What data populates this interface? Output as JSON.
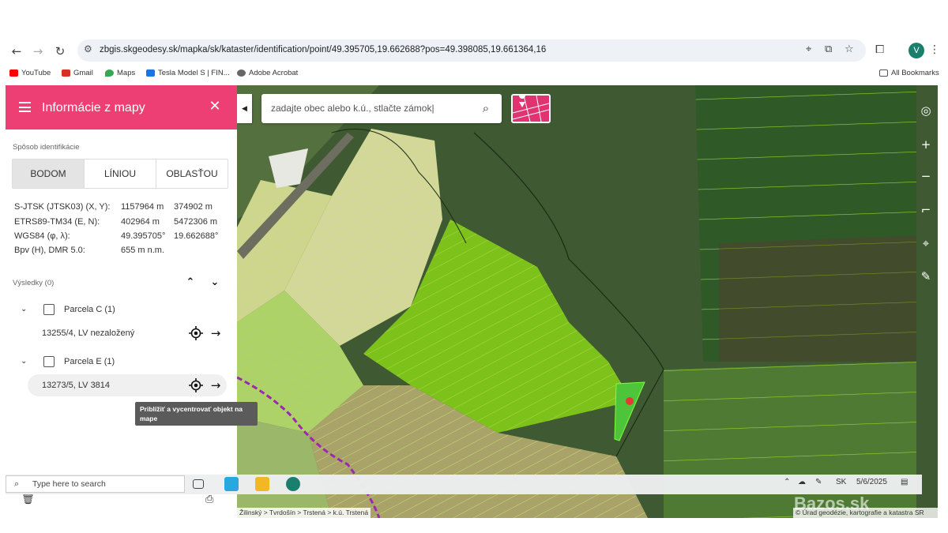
{
  "browser": {
    "url": "zbgis.skgeodesy.sk/mapka/sk/kataster/identification/point/49.395705,19.662688?pos=49.398085,19.661364,16",
    "profile_initial": "V",
    "bookmarks": [
      {
        "label": "YouTube",
        "color": "#ff0000"
      },
      {
        "label": "Gmail",
        "color": "#d93025"
      },
      {
        "label": "Maps",
        "color": "#34a853"
      },
      {
        "label": "Tesla Model S | FIN...",
        "color": "#1a73e8"
      },
      {
        "label": "Adobe Acrobat",
        "color": "#666666"
      }
    ],
    "all_bookmarks": "All Bookmarks"
  },
  "sidebar": {
    "title": "Informácie z mapy",
    "identification_label": "Spôsob identifikácie",
    "modes": [
      "BODOM",
      "LÍNIOU",
      "OBLASŤOU"
    ],
    "active_mode": "BODOM",
    "coordinates": [
      {
        "label": "S-JTSK (JTSK03) (X, Y):",
        "v1": "1157964 m",
        "v2": "374902 m"
      },
      {
        "label": "ETRS89-TM34 (E, N):",
        "v1": "402964 m",
        "v2": "5472306 m"
      },
      {
        "label": "WGS84 (φ, λ):",
        "v1": "49.395705°",
        "v2": "19.662688°"
      },
      {
        "label": "Bpv (H), DMR 5.0:",
        "v1": "655 m n.m.",
        "v2": ""
      }
    ],
    "results_label": "Výsledky (0)",
    "groups": [
      {
        "label": "Parcela C (1)",
        "item": "13255/4, LV nezaložený"
      },
      {
        "label": "Parcela E (1)",
        "item": "13273/5, LV 3814"
      }
    ],
    "tooltip": "Priblížiť a vycentrovať objekt na mape"
  },
  "map": {
    "search_placeholder": "zadajte obec alebo k.ú., stlačte zámok|",
    "breadcrumb": "Žilinský > Tvrdošín > Trstená > k.ú. Trstená",
    "copyright": "© Úrad geodézie, kartografie a katastra SR",
    "watermark": "Bazos.sk",
    "accent": "#ee3f74"
  },
  "taskbar": {
    "search_text": "Type here to search",
    "language": "SK",
    "date": "5/6/2025"
  }
}
